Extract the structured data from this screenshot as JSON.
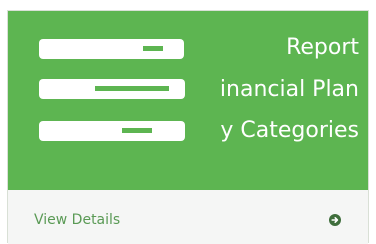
{
  "panel": {
    "title_lines": [
      "Report",
      "inancial Plan",
      "y Categories"
    ],
    "redactions": [
      "redacted-text",
      "redacted-text",
      "redacted-text"
    ],
    "footer": {
      "link_label": "View Details",
      "icon": "circle-arrow-right-icon"
    }
  },
  "colors": {
    "header_green": "#5db551",
    "link_green": "#5a9a55",
    "footer_bg": "#f5f6f5"
  }
}
